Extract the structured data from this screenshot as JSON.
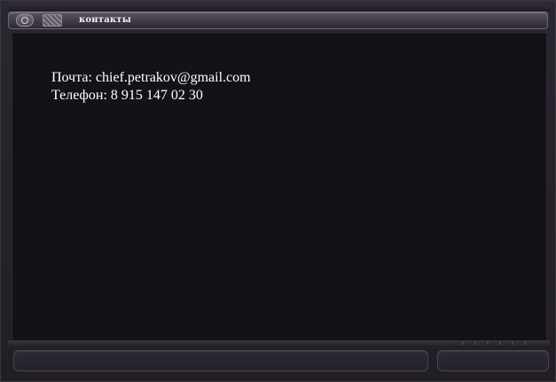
{
  "window": {
    "title": "контакты",
    "menu_icon": "circle-menu-icon",
    "image_icon": "image-icon"
  },
  "content": {
    "email_line": "Почта: chief.petrakov@gmail.com",
    "phone_line": "Телефон: 8 915 147 02 30"
  },
  "colors": {
    "background": "#141216",
    "frame": "#2b2730",
    "titlebar": "#4a4552",
    "text": "#ffffff"
  }
}
